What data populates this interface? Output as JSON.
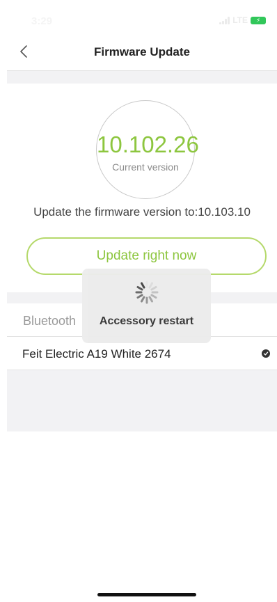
{
  "status_bar": {
    "time": "3:29",
    "network": "LTE"
  },
  "nav": {
    "title": "Firmware Update",
    "back_icon": "chevron-left-icon"
  },
  "firmware": {
    "current_version": "10.102.26",
    "current_version_label": "Current version",
    "update_text": "Update the firmware version to:10.103.10",
    "update_button_label": "Update right now"
  },
  "bluetooth": {
    "section_label": "Bluetooth",
    "device_name": "Feit Electric A19 White 2674"
  },
  "toast": {
    "message": "Accessory restart",
    "icon": "spinner-icon"
  },
  "colors": {
    "accent": "#8dc63f",
    "button_border": "#b5d96b",
    "background_gray": "#f2f2f4",
    "battery": "#31c75a"
  }
}
